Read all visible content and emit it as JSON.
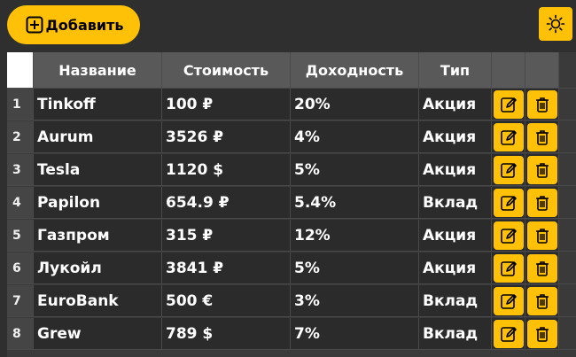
{
  "toolbar": {
    "add_label": "Добавить",
    "add_icon": "plus-square-icon",
    "theme_icon": "sun-icon"
  },
  "colors": {
    "accent": "#ffc107",
    "background": "#2f2f2f",
    "header_bg": "#595959",
    "cell_bg": "#2b2b2b"
  },
  "table": {
    "columns": [
      "Название",
      "Стоимость",
      "Доходность",
      "Тип"
    ],
    "rows": [
      {
        "index": "1",
        "name": "Tinkoff",
        "cost": "100 ₽",
        "yield": "20%",
        "type": "Акция"
      },
      {
        "index": "2",
        "name": "Aurum",
        "cost": "3526 ₽",
        "yield": "4%",
        "type": "Акция"
      },
      {
        "index": "3",
        "name": "Tesla",
        "cost": "1120 $",
        "yield": "5%",
        "type": "Акция"
      },
      {
        "index": "4",
        "name": "Papilon",
        "cost": "654.9 ₽",
        "yield": "5.4%",
        "type": "Вклад"
      },
      {
        "index": "5",
        "name": "Газпром",
        "cost": "315 ₽",
        "yield": "12%",
        "type": "Акция"
      },
      {
        "index": "6",
        "name": "Лукойл",
        "cost": "3841 ₽",
        "yield": "5%",
        "type": "Акция"
      },
      {
        "index": "7",
        "name": "EuroBank",
        "cost": "500 €",
        "yield": "3%",
        "type": "Вклад"
      },
      {
        "index": "8",
        "name": "Grew",
        "cost": "789 $",
        "yield": "7%",
        "type": "Вклад"
      }
    ],
    "row_actions": [
      "edit-icon",
      "trash-icon"
    ]
  }
}
